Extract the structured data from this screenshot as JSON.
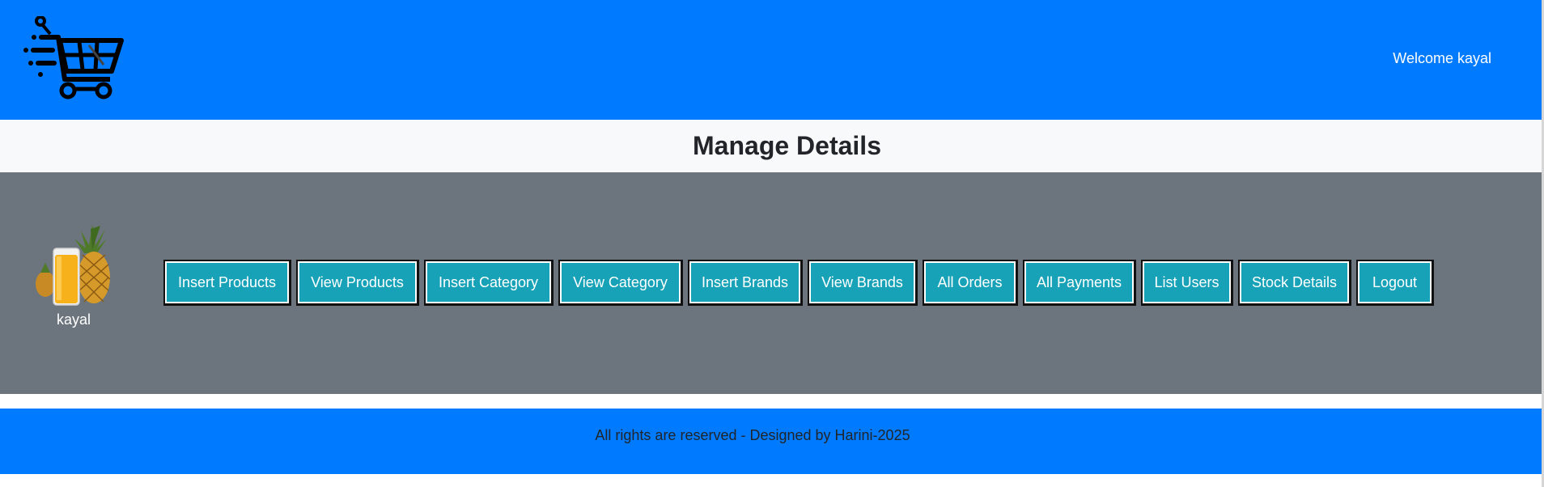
{
  "header": {
    "logo_icon": "shopping-cart-logo-icon",
    "welcome_text": "Welcome kayal"
  },
  "title": "Manage Details",
  "admin": {
    "avatar_icon": "juice-pineapple-image",
    "username": "kayal"
  },
  "buttons": [
    {
      "label": "Insert Products"
    },
    {
      "label": "View Products"
    },
    {
      "label": "Insert Category"
    },
    {
      "label": "View Category"
    },
    {
      "label": "Insert Brands"
    },
    {
      "label": "View Brands"
    },
    {
      "label": "All Orders"
    },
    {
      "label": "All Payments"
    },
    {
      "label": "List Users"
    },
    {
      "label": "Stock Details"
    },
    {
      "label": "Logout"
    }
  ],
  "footer": {
    "text": "All rights are reserved - Designed by Harini-2025"
  },
  "colors": {
    "primary": "#007bff",
    "secondary": "#6c757d",
    "info": "#17a2b8",
    "light": "#f8f9fa"
  }
}
